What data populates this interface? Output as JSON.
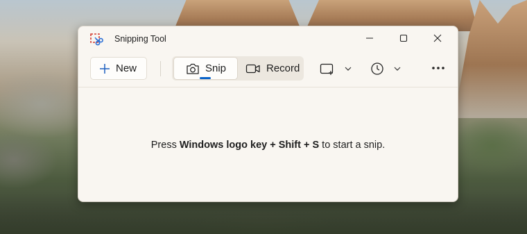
{
  "window": {
    "title": "Snipping Tool",
    "controls": [
      "minimize",
      "maximize",
      "close"
    ]
  },
  "toolbar": {
    "new_label": "New",
    "snip_label": "Snip",
    "record_label": "Record",
    "snip_mode_icon": "rectangle-mode-icon",
    "delay_icon": "clock-icon",
    "more_icon": "more-options-icon"
  },
  "hint": {
    "prefix": "Press ",
    "keys": "Windows logo key + Shift + S",
    "suffix": " to start a snip."
  },
  "colors": {
    "accent": "#0a63c9",
    "window_bg": "#f9f6f1"
  }
}
